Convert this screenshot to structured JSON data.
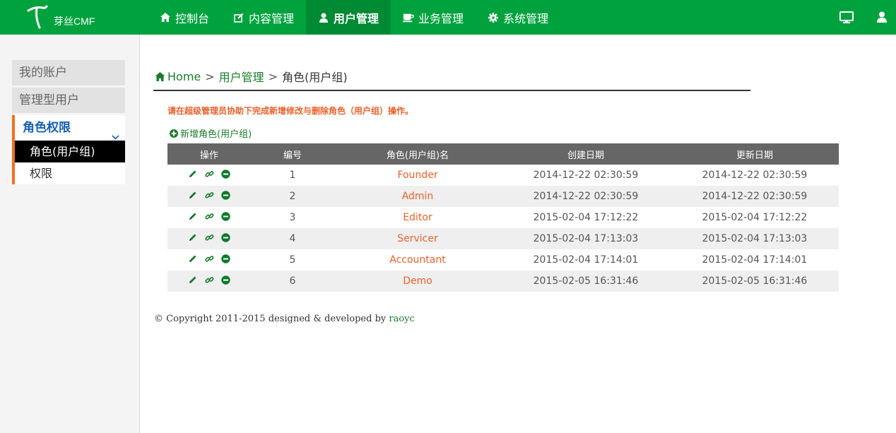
{
  "header": {
    "logo_text": "芽丝CMF",
    "nav": [
      {
        "label": "控制台",
        "icon": "home-icon"
      },
      {
        "label": "内容管理",
        "icon": "edit-icon"
      },
      {
        "label": "用户管理",
        "icon": "user-icon",
        "active": true
      },
      {
        "label": "业务管理",
        "icon": "coffee-icon"
      },
      {
        "label": "系统管理",
        "icon": "gear-icon"
      }
    ],
    "right_icons": [
      "monitor-icon",
      "user-icon"
    ]
  },
  "sidebar": {
    "items": [
      {
        "label": "我的账户"
      },
      {
        "label": "管理型用户"
      }
    ],
    "group": {
      "label": "角色权限",
      "children": [
        {
          "label": "角色(用户组)",
          "active": true
        },
        {
          "label": "权限"
        }
      ]
    }
  },
  "breadcrumb": {
    "home": "Home",
    "sep": ">",
    "section": "用户管理",
    "current": "角色(用户组)"
  },
  "notice": "请在超级管理员协助下完成新增修改与删除角色（用户组）操作。",
  "add_role_label": "新增角色(用户组)",
  "table": {
    "headers": [
      "操作",
      "编号",
      "角色(用户组)名",
      "创建日期",
      "更新日期"
    ],
    "rows": [
      {
        "id": "1",
        "name": "Founder",
        "created": "2014-12-22 02:30:59",
        "updated": "2014-12-22 02:30:59"
      },
      {
        "id": "2",
        "name": "Admin",
        "created": "2014-12-22 02:30:59",
        "updated": "2014-12-22 02:30:59"
      },
      {
        "id": "3",
        "name": "Editor",
        "created": "2015-02-04 17:12:22",
        "updated": "2015-02-04 17:12:22"
      },
      {
        "id": "4",
        "name": "Servicer",
        "created": "2015-02-04 17:13:03",
        "updated": "2015-02-04 17:13:03"
      },
      {
        "id": "5",
        "name": "Accountant",
        "created": "2015-02-04 17:14:01",
        "updated": "2015-02-04 17:14:01"
      },
      {
        "id": "6",
        "name": "Demo",
        "created": "2015-02-05 16:31:46",
        "updated": "2015-02-05 16:31:46"
      }
    ]
  },
  "footer": {
    "text": "© Copyright 2011-2015 designed & developed by ",
    "author": "raoyc"
  },
  "colors": {
    "brand_green": "#00a23e",
    "accent_orange": "#e8612a",
    "link_green": "#1a7c2a",
    "table_header": "#666666"
  }
}
